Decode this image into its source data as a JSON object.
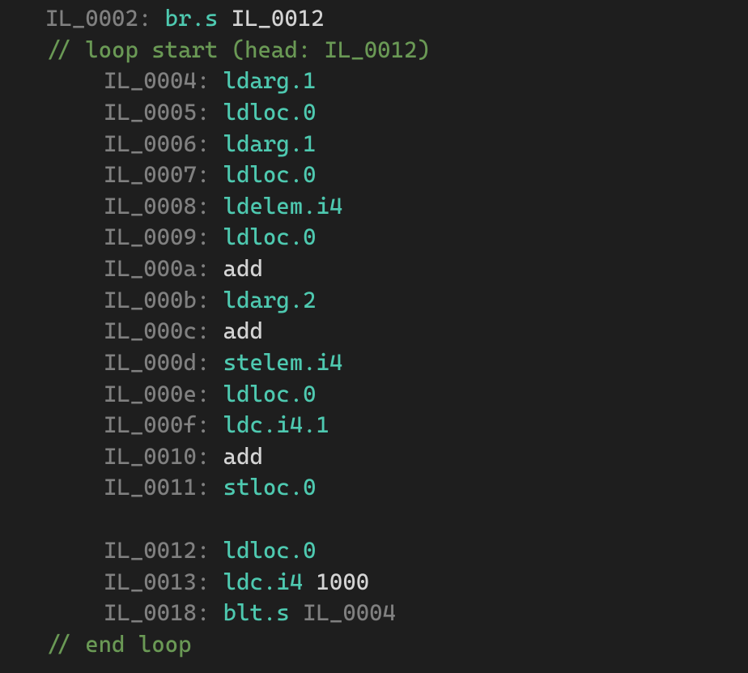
{
  "lines": [
    {
      "indent": 0,
      "label": "IL_0002:",
      "opcode": "br.s",
      "opcodeClass": "opcode",
      "target": " IL_0012",
      "targetClass": "target"
    },
    {
      "indent": 0,
      "comment": "// loop start (head: IL_0012)"
    },
    {
      "indent": 1,
      "label": "IL_0004:",
      "opcode": "ldarg.1",
      "opcodeClass": "opcode"
    },
    {
      "indent": 1,
      "label": "IL_0005:",
      "opcode": "ldloc.0",
      "opcodeClass": "opcode"
    },
    {
      "indent": 1,
      "label": "IL_0006:",
      "opcode": "ldarg.1",
      "opcodeClass": "opcode"
    },
    {
      "indent": 1,
      "label": "IL_0007:",
      "opcode": "ldloc.0",
      "opcodeClass": "opcode"
    },
    {
      "indent": 1,
      "label": "IL_0008:",
      "opcode": "ldelem.i4",
      "opcodeClass": "opcode"
    },
    {
      "indent": 1,
      "label": "IL_0009:",
      "opcode": "ldloc.0",
      "opcodeClass": "opcode"
    },
    {
      "indent": 1,
      "label": "IL_000a:",
      "opcode": "add",
      "opcodeClass": "opcode-white"
    },
    {
      "indent": 1,
      "label": "IL_000b:",
      "opcode": "ldarg.2",
      "opcodeClass": "opcode"
    },
    {
      "indent": 1,
      "label": "IL_000c:",
      "opcode": "add",
      "opcodeClass": "opcode-white"
    },
    {
      "indent": 1,
      "label": "IL_000d:",
      "opcode": "stelem.i4",
      "opcodeClass": "opcode"
    },
    {
      "indent": 1,
      "label": "IL_000e:",
      "opcode": "ldloc.0",
      "opcodeClass": "opcode"
    },
    {
      "indent": 1,
      "label": "IL_000f:",
      "opcode": "ldc.i4.1",
      "opcodeClass": "opcode"
    },
    {
      "indent": 1,
      "label": "IL_0010:",
      "opcode": "add",
      "opcodeClass": "opcode-white"
    },
    {
      "indent": 1,
      "label": "IL_0011:",
      "opcode": "stloc.0",
      "opcodeClass": "opcode"
    },
    {
      "blank": true
    },
    {
      "indent": 1,
      "label": "IL_0012:",
      "opcode": "ldloc.0",
      "opcodeClass": "opcode"
    },
    {
      "indent": 1,
      "label": "IL_0013:",
      "opcode": "ldc.i4",
      "opcodeClass": "opcode",
      "target": " 1000",
      "targetClass": "target"
    },
    {
      "indent": 1,
      "label": "IL_0018:",
      "opcode": "blt.s",
      "opcodeClass": "opcode",
      "target": " IL_0004",
      "targetClass": "target-gray"
    },
    {
      "indent": 0,
      "comment": "// end loop"
    }
  ]
}
